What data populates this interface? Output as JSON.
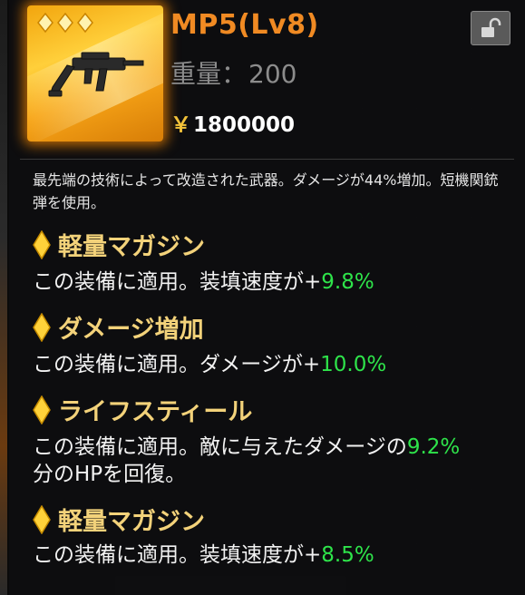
{
  "item": {
    "title": "MP5(Lv8)",
    "weight_label": "重量：",
    "weight_value": "200",
    "currency_symbol": "￥",
    "price": "1800000",
    "rarity_stars": 3,
    "icon": "submachine-gun-icon"
  },
  "lock": {
    "icon": "unlocked-padlock-icon"
  },
  "description": "最先端の技術によって改造された武器。ダメージが44%増加。短機関銃弾を使用。",
  "perks": [
    {
      "name": "軽量マガジン",
      "text": "この装備に適用。装填速度が+",
      "value": "9.8%",
      "suffix": ""
    },
    {
      "name": "ダメージ増加",
      "text": "この装備に適用。ダメージが+",
      "value": "10.0%",
      "suffix": ""
    },
    {
      "name": "ライフスティール",
      "text": "この装備に適用。敵に与えたダメージの",
      "value": "9.2%",
      "suffix": "分のHPを回復。"
    },
    {
      "name": "軽量マガジン",
      "text": "この装備に適用。装填速度が+",
      "value": "8.5%",
      "suffix": ""
    }
  ],
  "colors": {
    "title": "#f08a23",
    "perk_title": "#f3d27a",
    "perk_value": "#2ee34a",
    "rarity_gold": "#ffe27a"
  }
}
